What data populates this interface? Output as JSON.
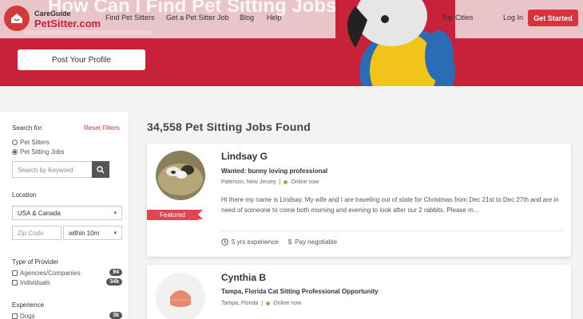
{
  "nav": {
    "logo_line1": "CareGuide",
    "logo_line2": "PetSitter.com",
    "links": [
      "Find Pet Sitters",
      "Get a Pet Sitter Job",
      "Blog",
      "Help"
    ],
    "top_cities": "Top Cities",
    "login": "Log In",
    "get_started": "Get Started"
  },
  "hero": {
    "headline": "How Can I Find Pet Sitting Jobs Near Me",
    "post_profile": "Post Your Profile"
  },
  "sidebar": {
    "search_for": "Search for:",
    "reset": "Reset Filters",
    "options": [
      "Pet Sitters",
      "Pet Sitting Jobs"
    ],
    "selected_option": "Pet Sitting Jobs",
    "keyword_placeholder": "Search by Keyword",
    "location_label": "Location",
    "location_value": "USA & Canada",
    "zip_placeholder": "Zip Code",
    "radius_value": "within 10m",
    "provider_label": "Type of Provider",
    "providers": [
      {
        "label": "Agencies/Companies",
        "count": "94"
      },
      {
        "label": "Individuals",
        "count": "34k"
      }
    ],
    "experience_label": "Experience",
    "experience_first": {
      "label": "Dogs",
      "count": "3k"
    }
  },
  "results": {
    "title": "34,558 Pet Sitting Jobs Found",
    "cards": [
      {
        "name": "Lindsay G",
        "headline": "Wanted: bunny loving professional",
        "location": "Paterson, New Jersey",
        "status": "Online now",
        "badge": "Featured",
        "body": "Hi there my name is Lindsay. My wife and I are traveling out of state for Christmas from Dec 21st to Dec 27th and are in need of someone to come both morning and evening to look after our 2 rabbits. Please m...",
        "experience": "5 yrs experience",
        "pay": "Pay negotiable"
      },
      {
        "name": "Cynthia B",
        "headline": "Tampa, Florida Cat Sitting Professional Opportunity",
        "location": "Tampa, Florida",
        "status": "Online now"
      }
    ]
  },
  "colors": {
    "brand_red": "#c8213a",
    "accent_red": "#d8333b",
    "online_green": "#7bc043"
  }
}
